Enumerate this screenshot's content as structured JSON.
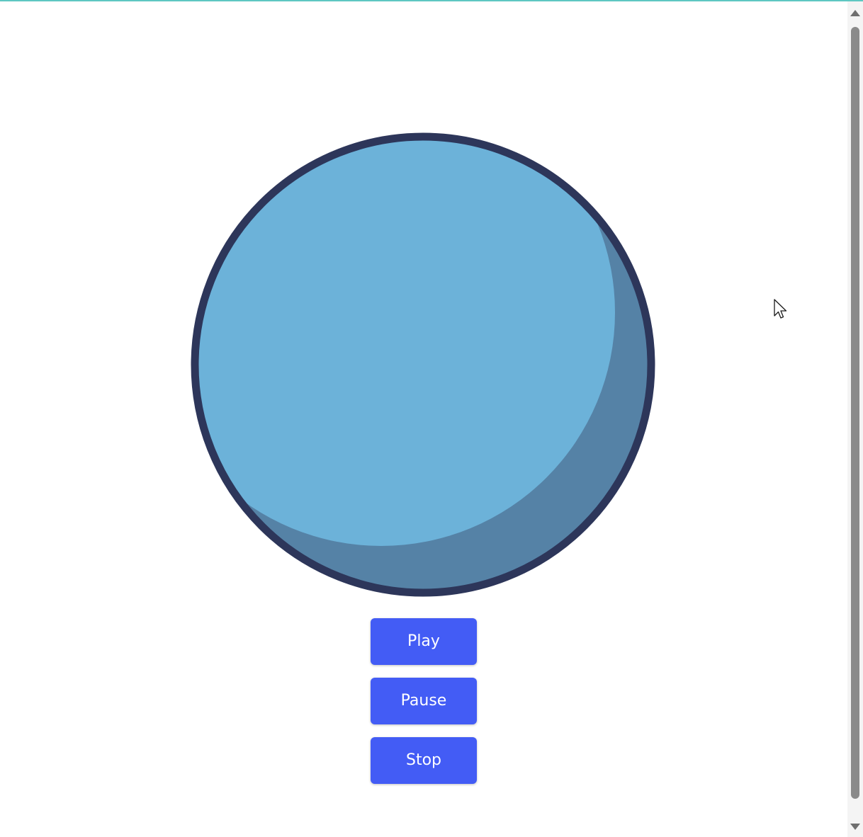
{
  "controls": {
    "play_label": "Play",
    "pause_label": "Pause",
    "stop_label": "Stop"
  },
  "colors": {
    "sphere_fill": "#6cb2d9",
    "sphere_shadow": "#5582a6",
    "sphere_outline": "#2d365a",
    "button_bg": "#435cf5",
    "button_text": "#ffffff",
    "top_accent": "#5ec7c2"
  },
  "icons": {
    "cursor": "mouse-pointer-icon",
    "scroll_up": "triangle-up-icon",
    "scroll_down": "triangle-down-icon"
  }
}
